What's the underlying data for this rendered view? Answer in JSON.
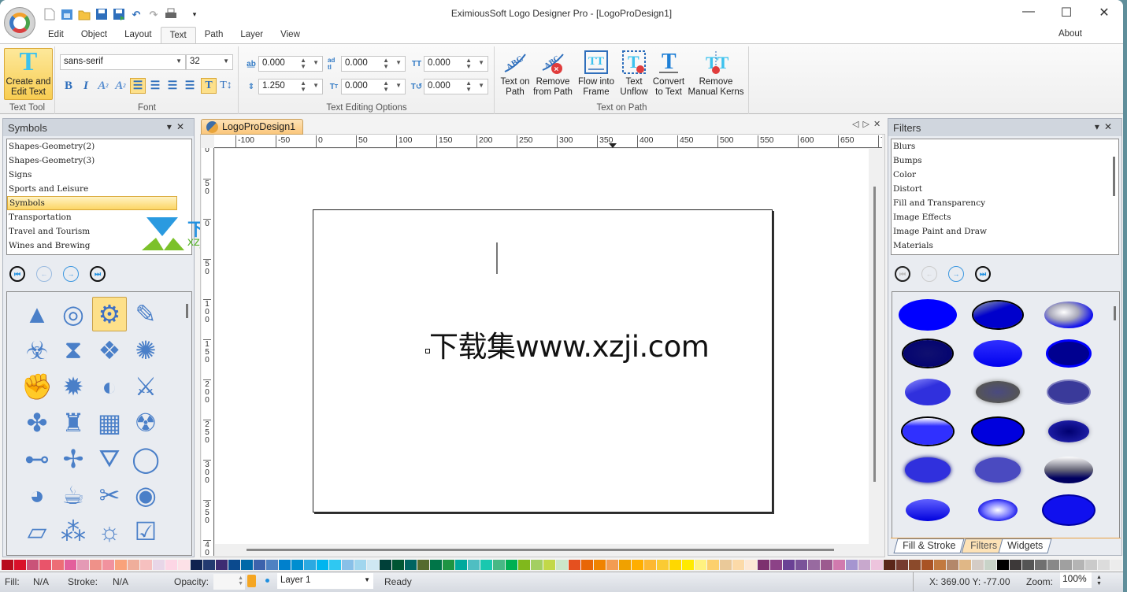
{
  "window": {
    "title": "EximiousSoft Logo Designer Pro - [LogoProDesign1]",
    "controls": [
      "minimize",
      "maximize",
      "close"
    ],
    "about_label": "About"
  },
  "quick_access": [
    "new-icon",
    "template-icon",
    "open-icon",
    "save-icon",
    "save-as-icon",
    "undo-icon",
    "redo-icon",
    "print-icon",
    "customize-icon"
  ],
  "menu_tabs": [
    {
      "label": "Edit",
      "active": false
    },
    {
      "label": "Object",
      "active": false
    },
    {
      "label": "Layout",
      "active": false
    },
    {
      "label": "Text",
      "active": true
    },
    {
      "label": "Path",
      "active": false
    },
    {
      "label": "Layer",
      "active": false
    },
    {
      "label": "View",
      "active": false
    }
  ],
  "ribbon": {
    "text_tool": {
      "button_label": "Create and Edit Text",
      "button_line1": "Create and",
      "button_line2": "Edit Text",
      "group_label": "Text Tool"
    },
    "font": {
      "family": "sans-serif",
      "size": "32",
      "group_label": "Font",
      "buttons": [
        "bold",
        "italic",
        "superscript",
        "subscript",
        "align-left",
        "align-center",
        "align-right",
        "justify",
        "horizontal-text",
        "vertical-text"
      ],
      "selected": [
        "align-left",
        "horizontal-text"
      ]
    },
    "text_editing": {
      "group_label": "Text Editing Options",
      "fields": [
        {
          "name": "letter-spacing",
          "value": "0.000"
        },
        {
          "name": "word-spacing",
          "value": "0.000"
        },
        {
          "name": "horizontal-kerning",
          "value": "0.000"
        },
        {
          "name": "line-spacing",
          "value": "1.250"
        },
        {
          "name": "vertical-shift",
          "value": "0.000"
        },
        {
          "name": "rotation",
          "value": "0.000"
        }
      ]
    },
    "text_on_path": {
      "group_label": "Text on Path",
      "buttons": [
        {
          "line1": "Text on",
          "line2": "Path"
        },
        {
          "line1": "Remove",
          "line2": "from Path"
        },
        {
          "line1": "Flow into",
          "line2": "Frame"
        },
        {
          "line1": "Text",
          "line2": "Unflow"
        },
        {
          "line1": "Convert",
          "line2": "to Text"
        },
        {
          "line1": "Remove",
          "line2": "Manual Kerns"
        }
      ]
    }
  },
  "symbols_panel": {
    "title": "Symbols",
    "categories": [
      "Shapes-Geometry(2)",
      "Shapes-Geometry(3)",
      "Signs",
      "Sports and Leisure",
      "Symbols",
      "Transportation",
      "Travel and Tourism",
      "Wines and Brewing"
    ],
    "selected_category": "Symbols",
    "nav": [
      "first",
      "previous",
      "next",
      "last"
    ],
    "symbols": [
      "landscape-frame",
      "mountain-circle",
      "gear",
      "pen-tools",
      "biohazard",
      "hourglass",
      "diamond-cluster",
      "dotted-circle",
      "fist",
      "sunburst",
      "swoosh-ball",
      "sword",
      "propeller",
      "torch",
      "checkerboard",
      "radiation",
      "connector",
      "swirl-triskelion",
      "shield-emblem",
      "crescent-ring",
      "eclipse",
      "coffee-cup",
      "comb-scissors",
      "eye-swirl",
      "notebook",
      "bubbles",
      "sun-ring",
      "checkbox"
    ],
    "selected_symbol": "gear"
  },
  "document": {
    "tab_label": "LogoProDesign1",
    "h_ruler": [
      "-100",
      "-50",
      "0",
      "50",
      "100",
      "150",
      "200",
      "250",
      "300",
      "350",
      "400",
      "450",
      "500",
      "550",
      "600",
      "650",
      "7"
    ],
    "v_ruler": [
      "0",
      "50",
      "0",
      "50",
      "100",
      "150",
      "200",
      "250",
      "300",
      "350",
      "40"
    ],
    "canvas_text": "下载集www.xzji.com"
  },
  "watermark": {
    "text": "下载集",
    "url": "xzji.com"
  },
  "filters_panel": {
    "title": "Filters",
    "categories": [
      "Blurs",
      "Bumps",
      "Color",
      "Distort",
      "Fill and Transparency",
      "Image Effects",
      "Image Paint and Draw",
      "Materials"
    ],
    "nav": [
      "first",
      "previous",
      "next",
      "last"
    ],
    "presets_count_visible": 18,
    "tabs": [
      {
        "label": "Fill & Stroke",
        "active": false
      },
      {
        "label": "Filters",
        "active": true
      },
      {
        "label": "Widgets",
        "active": false
      }
    ]
  },
  "palette": [
    "#b80c1c",
    "#d9112a",
    "#c95379",
    "#e9546a",
    "#ed6d76",
    "#e35f9c",
    "#e49ab5",
    "#ef9189",
    "#f1929e",
    "#f9a27a",
    "#efae9b",
    "#f6c0bf",
    "#e8d6e8",
    "#fdd6e5",
    "#fde1e7",
    "#0f2350",
    "#223a70",
    "#3d2c72",
    "#0b4a8e",
    "#0068a8",
    "#3d62ac",
    "#4f81c2",
    "#0080cc",
    "#008ed0",
    "#2ca9e1",
    "#00b5ef",
    "#2fc8f2",
    "#88c0e8",
    "#a0d6ee",
    "#cfe8f3",
    "#004039",
    "#005533",
    "#006461",
    "#556b2f",
    "#007548",
    "#1e9442",
    "#00a99d",
    "#4fbec2",
    "#19c8af",
    "#47b885",
    "#00b052",
    "#80b81c",
    "#a3cf62",
    "#c2d848",
    "#cce6c9",
    "#e5501f",
    "#e86606",
    "#f08300",
    "#f39c52",
    "#f0a100",
    "#ffae00",
    "#fdb832",
    "#facb33",
    "#ffd800",
    "#ffea00",
    "#fff27f",
    "#fcd06d",
    "#eac999",
    "#fcdaa8",
    "#fde8d5",
    "#7d306f",
    "#8c4287",
    "#6a4195",
    "#7a5399",
    "#986aa0",
    "#9c5b8f",
    "#d17aae",
    "#a595d0",
    "#c8a8cd",
    "#edc4dd",
    "#5b2619",
    "#763b2f",
    "#8b4a2b",
    "#a95325",
    "#c2793f",
    "#b3876a",
    "#e0b786",
    "#d4ccc6",
    "#c8d3c8",
    "#000000",
    "#3d3939",
    "#555555",
    "#707070",
    "#888888",
    "#a0a0a0",
    "#b4b4b4",
    "#cacaca",
    "#dcdcdc",
    "#ececec"
  ],
  "status": {
    "fill_label": "Fill:",
    "fill_value": "N/A",
    "stroke_label": "Stroke:",
    "stroke_value": "N/A",
    "opacity_label": "Opacity:",
    "opacity_value": "",
    "layer": "Layer 1",
    "message": "Ready",
    "coords": "X: 369.00 Y: -77.00",
    "zoom_label": "Zoom:",
    "zoom_value": "100%"
  }
}
